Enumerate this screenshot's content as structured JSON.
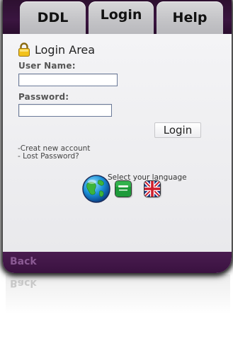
{
  "nav": {
    "tabs": [
      {
        "label": "DDL"
      },
      {
        "label": "Login"
      },
      {
        "label": "Help"
      }
    ]
  },
  "login": {
    "title": "Login Area",
    "username_label": "User Name:",
    "username_value": "",
    "password_label": "Password:",
    "password_value": "",
    "submit_label": "Login"
  },
  "links": {
    "create_account": "-Creat new account",
    "lost_password": "- Lost Password?"
  },
  "language": {
    "prompt": "Select your language",
    "options": [
      {
        "name": "Arabic",
        "icon": "saudi-flag-icon"
      },
      {
        "name": "English",
        "icon": "uk-flag-icon"
      }
    ]
  },
  "footer": {
    "back_label": "Back"
  },
  "colors": {
    "topbar": "#3a1540",
    "tab": "#c6c6c9",
    "bottombar": "#45184b",
    "back_text": "#8a5a93"
  }
}
